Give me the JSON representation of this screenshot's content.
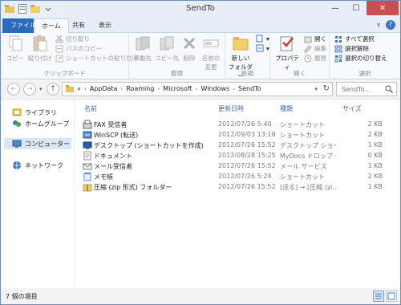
{
  "window": {
    "title": "SendTo",
    "controls": {
      "minimize": "—",
      "maximize": "☐",
      "close": "✕"
    }
  },
  "tabs": {
    "file": "ファイル",
    "home": "ホーム",
    "share": "共有",
    "view": "表示",
    "help": "?"
  },
  "ribbon": {
    "clipboard": {
      "label": "クリップボード",
      "copy": "コピー",
      "paste": "貼り付け",
      "cut": "切り取り",
      "copy_path": "パスのコピー",
      "paste_shortcut": "ショートカットの貼り付け"
    },
    "organize": {
      "label": "整理",
      "move_to": "移動先",
      "copy_to": "コピー先",
      "delete": "削除",
      "rename_1": "名前の",
      "rename_2": "変更"
    },
    "new": {
      "label": "新規",
      "new_folder_1": "新しい",
      "new_folder_2": "フォルダー"
    },
    "open": {
      "label": "開く",
      "properties": "プロパティ",
      "open": "開く",
      "edit": "編集",
      "history": "履歴"
    },
    "select": {
      "label": "選択",
      "select_all": "すべて選択",
      "select_none": "選択解除",
      "invert": "選択の切り替え"
    }
  },
  "address": {
    "prefix": "«",
    "crumbs": [
      "AppData",
      "Roaming",
      "Microsoft",
      "Windows",
      "SendTo"
    ],
    "search_placeholder": "SendTo..."
  },
  "nav_pane": {
    "items": [
      {
        "label": "ライブラリ"
      },
      {
        "label": "ホームグループ"
      },
      {
        "label": "コンピューター"
      },
      {
        "label": "ネットワーク"
      }
    ]
  },
  "file_list": {
    "columns": {
      "name": "名前",
      "date": "更新日時",
      "type": "種類",
      "size": "サイズ"
    },
    "rows": [
      {
        "name": "FAX 受信者",
        "date": "2012/07/26 5:40",
        "type": "ショートカット",
        "size": "2 KB"
      },
      {
        "name": "WinSCP (転送)",
        "date": "2012/09/03 13:18",
        "type": "ショートカット",
        "size": "2 KB"
      },
      {
        "name": "デスクトップ (ショートカットを作成)",
        "date": "2012/07/26 15:52",
        "type": "デスクトップ ショート...",
        "size": "1 KB"
      },
      {
        "name": "ドキュメント",
        "date": "2012/08/28 15:25",
        "type": "MyDocs ドロップ タ...",
        "size": "0 KB"
      },
      {
        "name": "メール受信者",
        "date": "2012/07/26 15:52",
        "type": "メール サービス",
        "size": "1 KB"
      },
      {
        "name": "メモ帳",
        "date": "2012/07/26 5:24",
        "type": "ショートカット",
        "size": "2 KB"
      },
      {
        "name": "圧縮 (zip 形式) フォルダー",
        "date": "2012/07/26 15:52",
        "type": "[送る] → [圧縮 (zi...",
        "size": "1 KB"
      }
    ]
  },
  "status": {
    "item_count": "7 個の項目"
  }
}
